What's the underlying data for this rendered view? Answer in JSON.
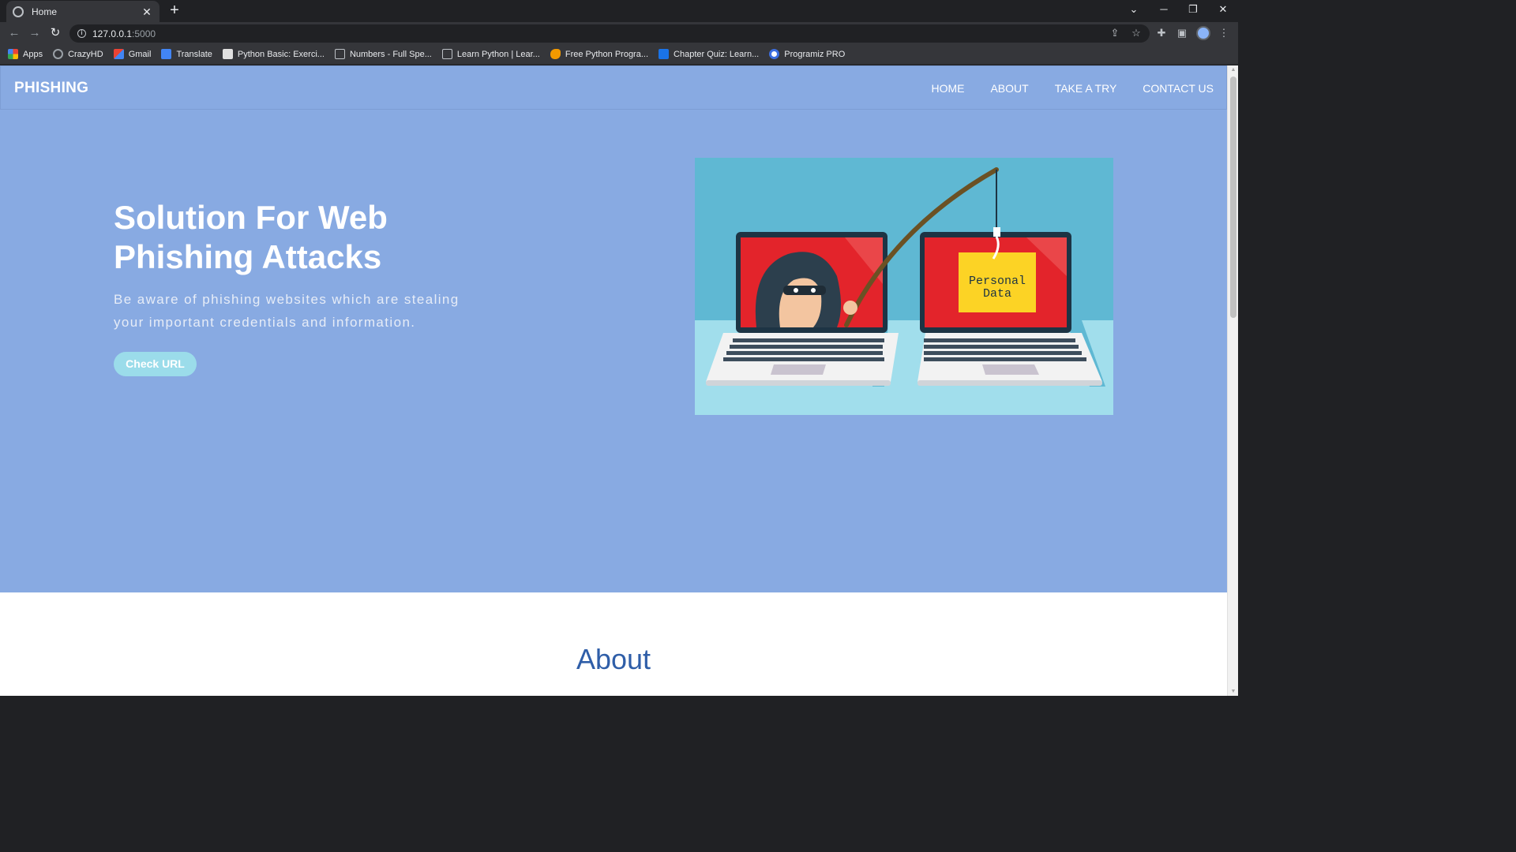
{
  "browser": {
    "tab_title": "Home",
    "close_glyph": "✕",
    "newtab_glyph": "+",
    "window": {
      "minimize": "─",
      "restore": "❐",
      "close": "✕",
      "tab_search": "⌄"
    },
    "url_host": "127.0.0.1",
    "url_port": ":5000",
    "bookmarks": [
      {
        "label": "Apps",
        "icon": "apps-grid-icon",
        "color": "#e8453c"
      },
      {
        "label": "CrazyHD",
        "icon": "globe-icon",
        "color": "#9aa0a6"
      },
      {
        "label": "Gmail",
        "icon": "gmail-icon",
        "color": "#ea4335"
      },
      {
        "label": "Translate",
        "icon": "translate-icon",
        "color": "#4285f4"
      },
      {
        "label": "Python Basic: Exerci...",
        "icon": "w3resource-icon",
        "color": "#e0e0e0"
      },
      {
        "label": "Numbers - Full Spe...",
        "icon": "terminal-icon",
        "color": "#bdc1c6"
      },
      {
        "label": "Learn Python | Lear...",
        "icon": "page-icon",
        "color": "#bdc1c6"
      },
      {
        "label": "Free Python Progra...",
        "icon": "africa-icon",
        "color": "#f29900"
      },
      {
        "label": "Chapter Quiz: Learn...",
        "icon": "video-icon",
        "color": "#1a73e8"
      },
      {
        "label": "Programiz PRO",
        "icon": "programiz-icon",
        "color": "#3c6ee0"
      }
    ]
  },
  "site": {
    "brand": "PHISHING",
    "nav": [
      "HOME",
      "ABOUT",
      "TAKE A TRY",
      "CONTACT US"
    ],
    "hero": {
      "title": "Solution For Web Phishing Attacks",
      "subtitle": "Be aware of phishing websites which are stealing your important credentials and information.",
      "cta": "Check URL"
    },
    "illustration": {
      "folder_text_line1": "Personal",
      "folder_text_line2": "Data"
    },
    "about_heading": "About"
  },
  "colors": {
    "hero_bg": "#88aae2",
    "cta_bg": "#9bdcea",
    "about_heading": "#2f5ea8"
  }
}
